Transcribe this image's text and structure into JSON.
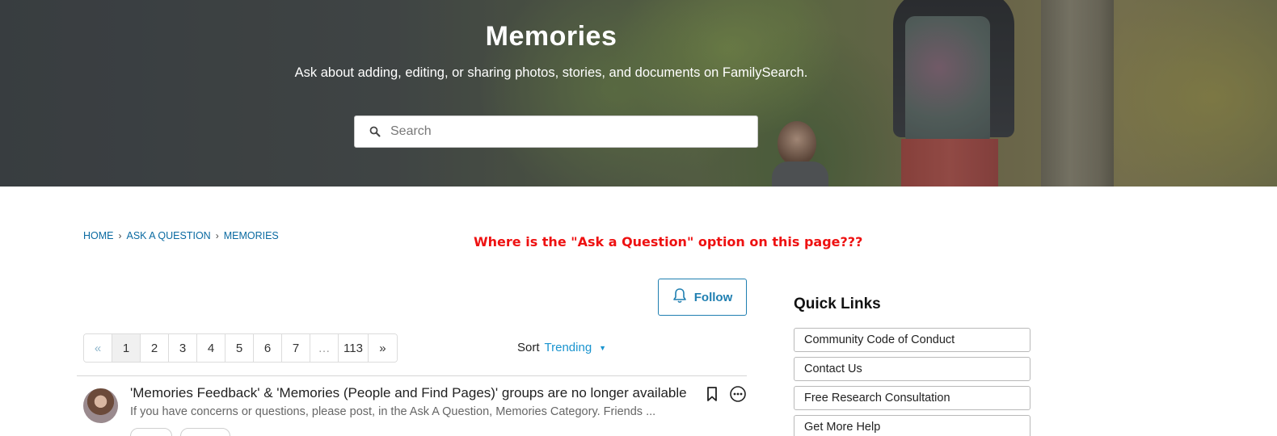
{
  "hero": {
    "title": "Memories",
    "subtitle": "Ask about adding, editing, or sharing photos, stories, and documents on FamilySearch.",
    "search_placeholder": "Search"
  },
  "breadcrumb": [
    "HOME",
    "ASK A QUESTION",
    "MEMORIES"
  ],
  "annotation": "Where is the \"Ask a Question\" option on this page???",
  "follow_label": "Follow",
  "pager": {
    "prev": "«",
    "pages": [
      "1",
      "2",
      "3",
      "4",
      "5",
      "6",
      "7",
      "…",
      "113"
    ],
    "next": "»",
    "current": "1"
  },
  "sort": {
    "label": "Sort",
    "value": "Trending"
  },
  "post": {
    "title": "'Memories Feedback' & 'Memories (People and Find Pages)' groups are no longer available",
    "excerpt": "If you have concerns or questions, please post, in the Ask A Question, Memories Category.  Friends ..."
  },
  "quick_links": {
    "title": "Quick Links",
    "items": [
      "Community Code of Conduct",
      "Contact Us",
      "Free Research Consultation",
      "Get More Help"
    ]
  },
  "colors": {
    "link": "#0a6aa1",
    "accent": "#1a94cf",
    "annotation": "#ee1111",
    "follow": "#1f7fb1"
  }
}
